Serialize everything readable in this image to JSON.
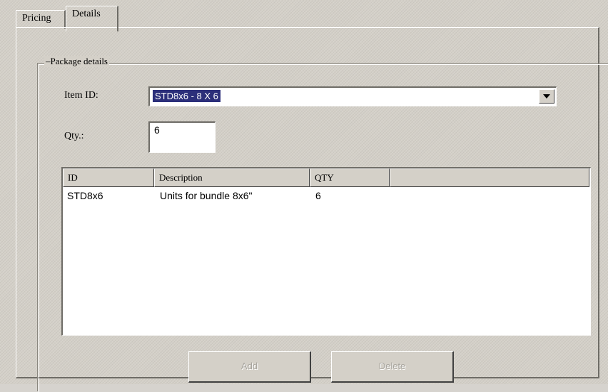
{
  "tabs": [
    {
      "label": "Pricing",
      "active": false
    },
    {
      "label": "Details",
      "active": true
    }
  ],
  "group": {
    "legend": "Package details"
  },
  "form": {
    "item_id_label": "Item ID:",
    "item_id_value": "STD8x6 - 8 X 6",
    "qty_label": "Qty.:",
    "qty_value": "6"
  },
  "table": {
    "columns": [
      "ID",
      "Description",
      "QTY"
    ],
    "rows": [
      {
        "id": "STD8x6",
        "description": "Units for bundle 8x6\"",
        "qty": "6"
      }
    ]
  },
  "buttons": {
    "add_label": "Add",
    "delete_label": "Delete",
    "enabled": false
  },
  "colors": {
    "face": "#d4d0c8",
    "selection": "#2c2f7a",
    "disabled_text": "#a8a59e"
  },
  "icons": {
    "combo_dropdown": "chevron-down-icon"
  }
}
